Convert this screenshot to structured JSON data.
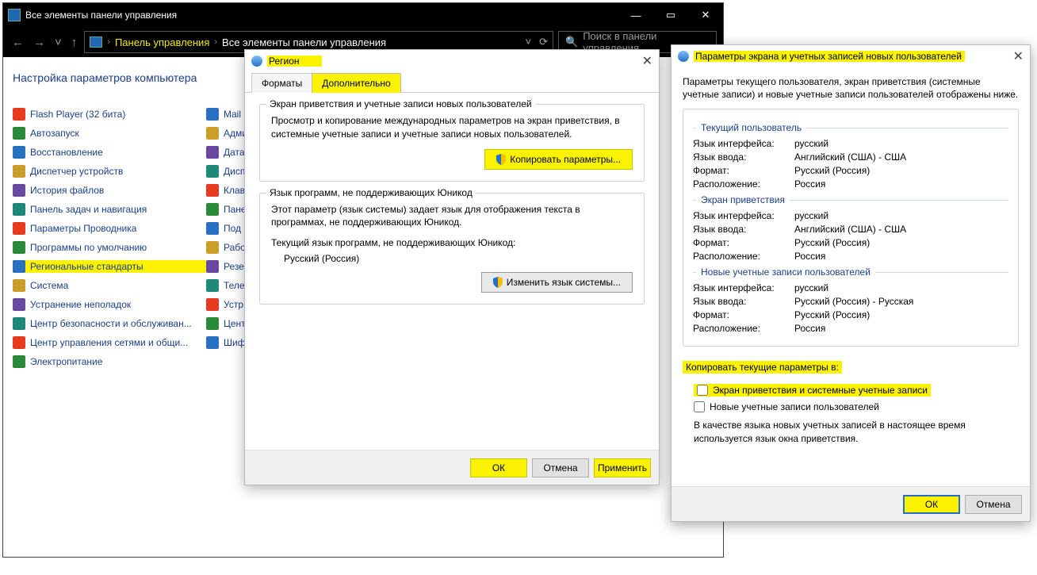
{
  "cp": {
    "window_title": "Все элементы панели управления",
    "breadcrumb1": "Панель управления",
    "breadcrumb2": "Все элементы панели управления",
    "search_placeholder": "Поиск в панели управления",
    "heading": "Настройка параметров компьютера",
    "items_col1": [
      "Flash Player (32 бита)",
      "Автозапуск",
      "Восстановление",
      "Диспетчер устройств",
      "История файлов",
      "Панель задач и навигация",
      "Параметры Проводника",
      "Программы по умолчанию",
      "Региональные стандарты",
      "Система",
      "Устранение неполадок",
      "Центр безопасности и обслуживан...",
      "Центр управления сетями и общи...",
      "Электропитание"
    ],
    "items_col2": [
      "Mail",
      "Адми",
      "Дата",
      "Дисп",
      "Клав",
      "Пане",
      "Под",
      "Рабо",
      "Резе",
      "Теле",
      "Устр",
      "Цент",
      "Шиф"
    ],
    "hl_index_col1": 8
  },
  "region": {
    "title": "Регион",
    "tab_formats": "Форматы",
    "tab_additional": "Дополнительно",
    "group1_legend": "Экран приветствия и учетные записи новых пользователей",
    "group1_desc": "Просмотр и копирование международных параметров на экран приветствия, в системные учетные записи и учетные записи новых пользователей.",
    "btn_copy": "Копировать параметры...",
    "group2_legend": "Язык программ, не поддерживающих Юникод",
    "group2_desc": "Этот параметр (язык системы) задает язык для отображения текста в программах, не поддерживающих Юникод.",
    "group2_current_label": "Текущий язык программ, не поддерживающих Юникод:",
    "group2_current_value": "Русский (Россия)",
    "btn_change": "Изменить язык системы...",
    "ok": "ОК",
    "cancel": "Отмена",
    "apply": "Применить"
  },
  "welcome": {
    "title": "Параметры экрана и учетных записей новых пользователей",
    "desc": "Параметры текущего пользователя, экран приветствия (системные учетные записи) и новые учетные записи пользователей отображены ниже.",
    "sections": {
      "current": "Текущий пользователь",
      "welcome_screen": "Экран приветствия",
      "new_user": "Новые учетные записи пользователей"
    },
    "labels": {
      "ui_lang": "Язык интерфейса:",
      "input_lang": "Язык ввода:",
      "format": "Формат:",
      "location": "Расположение:"
    },
    "current": {
      "ui": "русский",
      "input": "Английский (США) - США",
      "format": "Русский (Россия)",
      "location": "Россия"
    },
    "welcome_screen": {
      "ui": "русский",
      "input": "Английский (США) - США",
      "format": "Русский (Россия)",
      "location": "Россия"
    },
    "new_user": {
      "ui": "русский",
      "input": "Русский (Россия) - Русская",
      "format": "Русский (Россия)",
      "location": "Россия"
    },
    "copy_label": "Копировать текущие параметры в:",
    "check1": "Экран приветствия и системные учетные записи",
    "check2": "Новые учетные записи пользователей",
    "note": "В качестве языка новых учетных записей в настоящее время используется язык окна приветствия.",
    "ok": "ОК",
    "cancel": "Отмена"
  }
}
